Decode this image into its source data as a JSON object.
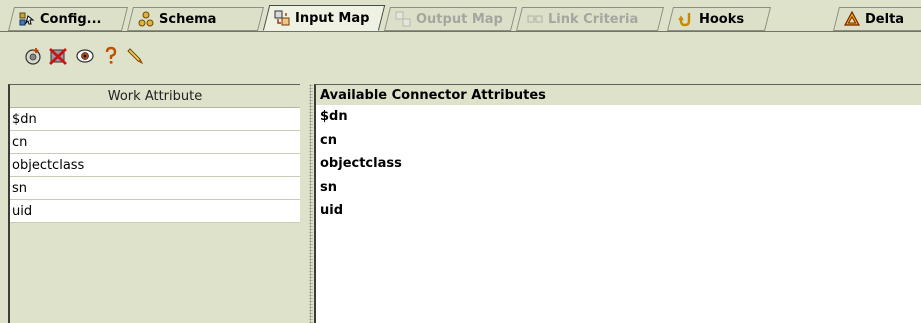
{
  "tabs": [
    {
      "label": "Config...",
      "icon": "config-icon",
      "state": "normal"
    },
    {
      "label": "Schema",
      "icon": "schema-icon",
      "state": "normal"
    },
    {
      "label": "Input Map",
      "icon": "input-map-icon",
      "state": "active"
    },
    {
      "label": "Output Map",
      "icon": "output-map-icon",
      "state": "disabled"
    },
    {
      "label": "Link Criteria",
      "icon": "link-criteria-icon",
      "state": "disabled"
    },
    {
      "label": "Hooks",
      "icon": "hooks-icon",
      "state": "normal"
    },
    {
      "label": "Delta",
      "icon": "delta-icon",
      "state": "normal"
    }
  ],
  "toolbar": {
    "buttons": [
      {
        "icon": "add-attribute-icon"
      },
      {
        "icon": "delete-attribute-icon"
      },
      {
        "icon": "view-icon"
      },
      {
        "icon": "help-icon"
      },
      {
        "icon": "pencil-icon"
      }
    ]
  },
  "work_attributes": {
    "header": "Work Attribute",
    "rows": [
      "$dn",
      "cn",
      "objectclass",
      "sn",
      "uid"
    ]
  },
  "connector_attributes": {
    "header": "Available Connector Attributes",
    "rows": [
      "$dn",
      "cn",
      "objectclass",
      "sn",
      "uid"
    ]
  },
  "colors": {
    "background": "#dfe2cb",
    "active_tab": "#eff1e2",
    "disabled_text": "#a6a6a0"
  }
}
